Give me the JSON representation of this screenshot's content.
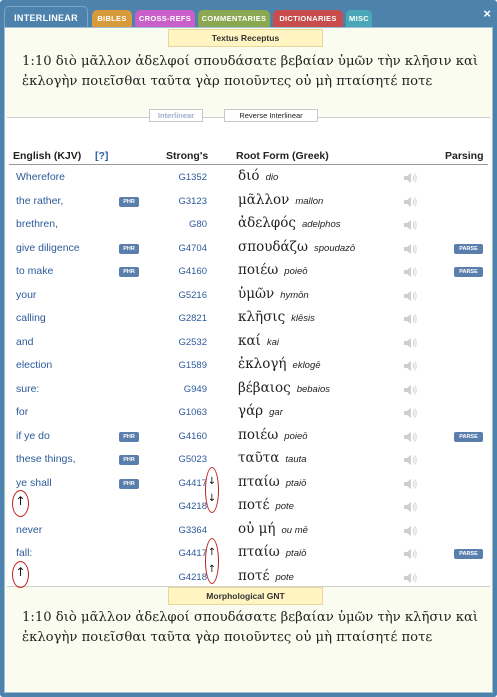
{
  "tabs": [
    {
      "label": "Interlinear",
      "color": "#4d82ad",
      "active": true
    },
    {
      "label": "Bibles",
      "color": "#d79a3c"
    },
    {
      "label": "Cross-Refs",
      "color": "#c95fc9"
    },
    {
      "label": "Commentaries",
      "color": "#8aa852"
    },
    {
      "label": "Dictionaries",
      "color": "#c94c4c"
    },
    {
      "label": "Misc",
      "color": "#4aa7b7"
    }
  ],
  "close_label": "×",
  "top_banner": "Textus Receptus",
  "top_verse": "1:10  διὸ μᾶλλον ἀδελφοί σπουδάσατε βεβαίαν ὑμῶν τὴν κλῆσιν καὶ ἐκλογὴν ποιεῖσθαι ταῦτα γὰρ ποιοῦντες οὐ μὴ πταίσητέ ποτε",
  "subtabs": {
    "interlinear": "Interlinear",
    "reverse": "Reverse Interlinear"
  },
  "headers": {
    "english": "English (KJV)",
    "help": "[?]",
    "strongs": "Strong's",
    "root": "Root Form (Greek)",
    "parsing": "Parsing"
  },
  "badges": {
    "phr": "PHR",
    "parse": "PARSE"
  },
  "rows": [
    {
      "english": "Wherefore",
      "phr": false,
      "strong": "G1352",
      "greek": "διό",
      "translit": "dio",
      "parse": false
    },
    {
      "english": "the rather,",
      "phr": true,
      "strong": "G3123",
      "greek": "μᾶλλον",
      "translit": "mallon",
      "parse": false
    },
    {
      "english": "brethren,",
      "phr": false,
      "strong": "G80",
      "greek": "ἀδελφός",
      "translit": "adelphos",
      "parse": false
    },
    {
      "english": "give diligence",
      "phr": true,
      "strong": "G4704",
      "greek": "σπουδάζω",
      "translit": "spoudazō",
      "parse": true
    },
    {
      "english": "to make",
      "phr": true,
      "strong": "G4160",
      "greek": "ποιέω",
      "translit": "poieō",
      "parse": true
    },
    {
      "english": "your",
      "phr": false,
      "strong": "G5216",
      "greek": "ὑμῶν",
      "translit": "hymōn",
      "parse": false
    },
    {
      "english": "calling",
      "phr": false,
      "strong": "G2821",
      "greek": "κλῆσις",
      "translit": "klēsis",
      "parse": false
    },
    {
      "english": "and",
      "phr": false,
      "strong": "G2532",
      "greek": "καί",
      "translit": "kai",
      "parse": false
    },
    {
      "english": "election",
      "phr": false,
      "strong": "G1589",
      "greek": "ἐκλογή",
      "translit": "eklogē",
      "parse": false
    },
    {
      "english": "sure:",
      "phr": false,
      "strong": "G949",
      "greek": "βέβαιος",
      "translit": "bebaios",
      "parse": false
    },
    {
      "english": "for",
      "phr": false,
      "strong": "G1063",
      "greek": "γάρ",
      "translit": "gar",
      "parse": false
    },
    {
      "english": "if ye do",
      "phr": true,
      "strong": "G4160",
      "greek": "ποιέω",
      "translit": "poieō",
      "parse": true
    },
    {
      "english": "these things,",
      "phr": true,
      "strong": "G5023",
      "greek": "ταῦτα",
      "translit": "tauta",
      "parse": false
    },
    {
      "english": "ye shall",
      "phr": true,
      "strong": "G4417",
      "greek": "πταίω",
      "translit": "ptaiō",
      "parse": false
    },
    {
      "english": "",
      "phr": false,
      "strong": "G4218",
      "greek": "ποτέ",
      "translit": "pote",
      "parse": false
    },
    {
      "english": "never",
      "phr": false,
      "strong": "G3364",
      "greek": "οὐ μή",
      "translit": "ou mē",
      "parse": false
    },
    {
      "english": "fall:",
      "phr": false,
      "strong": "G4417",
      "greek": "πταίω",
      "translit": "ptaiō",
      "parse": true
    },
    {
      "english": "",
      "phr": false,
      "strong": "G4218",
      "greek": "ποτέ",
      "translit": "pote",
      "parse": false
    }
  ],
  "annotation_arrows": {
    "up": "↑",
    "down": "↓"
  },
  "bottom_banner": "Morphological GNT",
  "bottom_verse": "1:10  διὸ μᾶλλον ἀδελφοί σπουδάσατε βεβαίαν ὑμῶν τὴν κλῆσιν καὶ ἐκλογὴν ποιεῖσθαι ταῦτα γὰρ ποιοῦντες οὐ μὴ πταίσητέ ποτε",
  "colors": {
    "accent": "#4d82ad",
    "link": "#2d5a9a",
    "badge": "#5b7fad",
    "annotation": "#c0201f",
    "banner": "#fff4c2"
  }
}
